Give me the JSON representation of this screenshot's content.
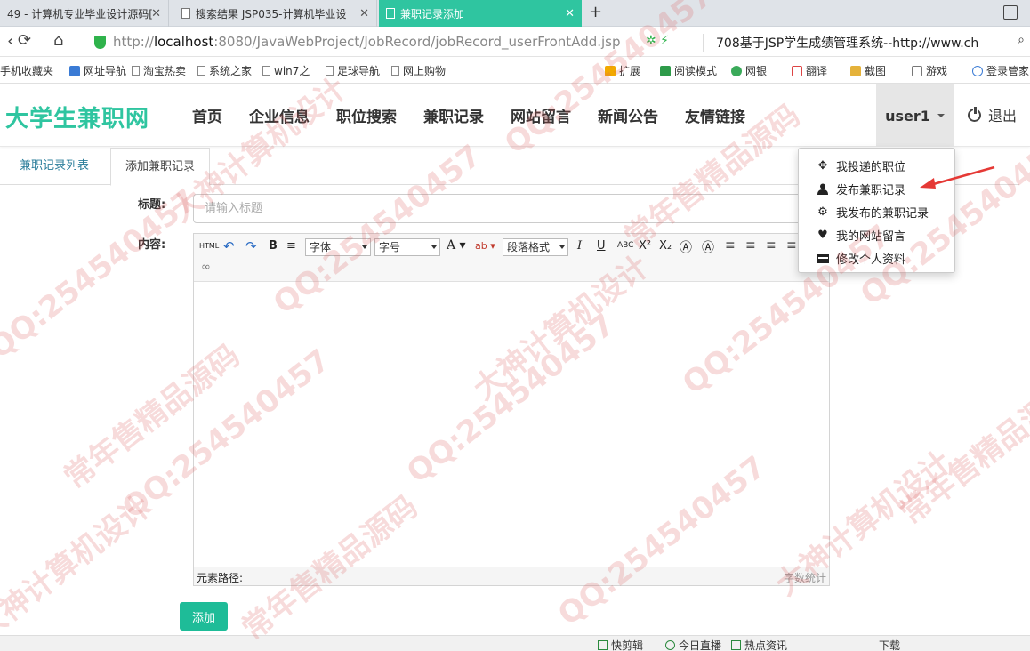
{
  "browser": {
    "tabs": [
      {
        "label": "49 - 计算机专业毕业设计源码[",
        "active": false
      },
      {
        "label": "搜索结果 JSP035-计算机毕业设",
        "active": false
      },
      {
        "label": "兼职记录添加",
        "active": true
      }
    ],
    "close_glyph": "✕",
    "new_tab": "+",
    "url_prefix": "http://",
    "url_host": "localhost",
    "url_rest": ":8080/JavaWebProject/JobRecord/jobRecord_userFrontAdd.jsp",
    "search_text": "708基于JSP学生成绩管理系统--http://www.ch",
    "bookmarks": [
      "手机收藏夹",
      "网址导航",
      "淘宝热卖",
      "系统之家",
      "win7之",
      "足球导航",
      "网上购物"
    ],
    "bookmark_tools": [
      "扩展",
      "阅读模式",
      "网银",
      "翻译",
      "截图",
      "游戏",
      "登录管家"
    ],
    "status_items": [
      "快剪辑",
      "今日直播",
      "热点资讯",
      "下载"
    ]
  },
  "site": {
    "brand": "大学生兼职网",
    "nav": [
      "首页",
      "企业信息",
      "职位搜索",
      "兼职记录",
      "网站留言",
      "新闻公告",
      "友情链接"
    ],
    "user": "user1",
    "logout": "退出"
  },
  "subtabs": [
    "兼职记录列表",
    "添加兼职记录"
  ],
  "form": {
    "title_label": "标题:",
    "title_placeholder": "请输入标题",
    "content_label": "内容:",
    "toolbar": {
      "html": "HTML",
      "font_family": "字体",
      "font_size": "字号",
      "paragraph": "段落格式"
    },
    "element_path": "元素路径:",
    "word_count": "字数统计",
    "submit": "添加"
  },
  "dropdown": [
    {
      "icon": "move-icon",
      "label": "我投递的职位"
    },
    {
      "icon": "user-icon",
      "label": "发布兼职记录"
    },
    {
      "icon": "gear-icon",
      "label": "我发布的兼职记录"
    },
    {
      "icon": "heart-icon",
      "label": "我的网站留言"
    },
    {
      "icon": "card-icon",
      "label": "修改个人资料"
    }
  ],
  "watermarks": [
    "QQ:254540457",
    "常年售精品源码",
    "大神计算机设计"
  ],
  "colors": {
    "brand": "#2fc5a0",
    "button": "#1ebc98",
    "tab_active": "#2fc5a0",
    "arrow": "#e53935"
  }
}
